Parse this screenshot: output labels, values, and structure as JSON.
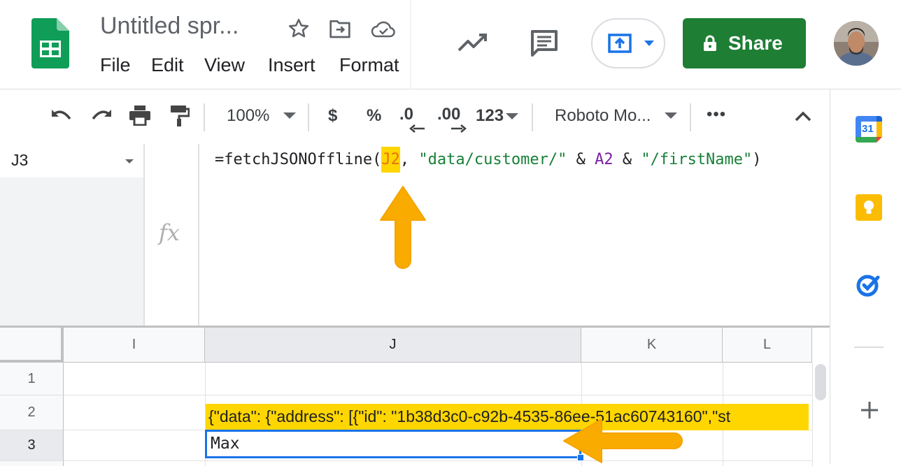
{
  "header": {
    "doc_title": "Untitled spr...",
    "menu": [
      "File",
      "Edit",
      "View",
      "Insert",
      "Format"
    ],
    "share_label": "Share"
  },
  "toolbar": {
    "zoom": "100%",
    "currency": "$",
    "percent": "%",
    "decrease_decimal": ".0",
    "increase_decimal": ".00",
    "more_formats": "123",
    "font": "Roboto Mo...",
    "more": "•••"
  },
  "formula_bar": {
    "cell_ref": "J3",
    "fx": "fx",
    "formula_parts": [
      "=fetchJSONOffline(",
      "J2",
      ", ",
      "\"data/customer/\"",
      " & ",
      "A2",
      " & ",
      "\"/firstName\"",
      ")"
    ]
  },
  "grid": {
    "columns": [
      "I",
      "J",
      "K",
      "L"
    ],
    "rows": [
      "1",
      "2",
      "3"
    ],
    "cells": {
      "J2": "{\"data\": {\"address\": [{\"id\": \"1b38d3c0-c92b-4535-86ee-51ac60743160\",\"st",
      "J3": "Max"
    }
  },
  "side_panel": {
    "calendar_day": "31"
  },
  "colors": {
    "sheets_green": "#0f9d58",
    "share_green": "#1e7e34",
    "highlight_yellow": "#ffd600",
    "arrow_orange": "#f9ab00",
    "selection_blue": "#1a73e8"
  }
}
